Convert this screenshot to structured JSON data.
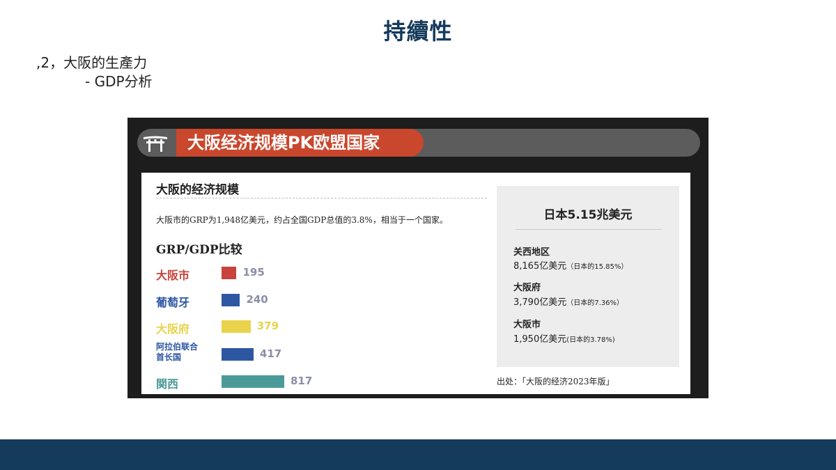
{
  "slide": {
    "title": "持續性",
    "outline_1": ",2，大阪的生產力",
    "outline_2": "- GDP分析"
  },
  "infographic": {
    "banner_title": "大阪经济规模PK欧盟国家",
    "section_title": "大阪的经济规模",
    "description": "大阪市的GRP为1,948亿美元，约占全国GDP总值的3.8%，相当于一个国家。",
    "comparison_title": "GRP/GDP比较",
    "source": "出处：「大阪的经济2023年版」"
  },
  "chart_data": {
    "type": "bar",
    "title": "GRP/GDP比较",
    "categories": [
      "大阪市",
      "葡萄牙",
      "大阪府",
      "阿拉伯联合首长国",
      "関西"
    ],
    "values": [
      195,
      240,
      379,
      417,
      817
    ],
    "label_lines": [
      [
        "大阪市"
      ],
      [
        "葡萄牙"
      ],
      [
        "大阪府"
      ],
      [
        "阿拉伯联合",
        "首长国"
      ],
      [
        "関西"
      ]
    ],
    "colors": [
      "#c8433b",
      "#2e57a3",
      "#e8d34a",
      "#2e57a3",
      "#4a9a97"
    ],
    "orientation": "horizontal"
  },
  "summary": {
    "japan_total": "日本5.15兆美元",
    "regions": [
      {
        "name": "关西地区",
        "value": "8,165亿美元",
        "share": "（日本的15.85%）"
      },
      {
        "name": "大阪府",
        "value": "3,790亿美元",
        "share": "（日本的7.36%）"
      },
      {
        "name": "大阪市",
        "value": "1,950亿美元",
        "share": "(日本的3.78%)"
      }
    ]
  },
  "colors": {
    "title": "#143a5c",
    "footer": "#143a5c",
    "banner_red": "#c9472d",
    "banner_grey": "#5c5c5c"
  }
}
